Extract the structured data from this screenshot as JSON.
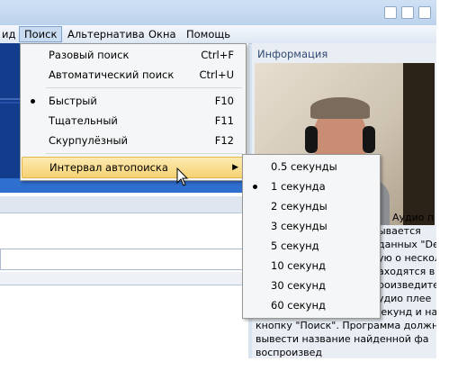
{
  "menubar": {
    "items": [
      "ид",
      "Поиск",
      "Альтернатива",
      "Окна",
      "Помощь"
    ],
    "active_index": 1
  },
  "dropdown": {
    "items": [
      {
        "label": "Разовый поиск",
        "shortcut": "Ctrl+F"
      },
      {
        "label": "Автоматический поиск",
        "shortcut": "Ctrl+U"
      },
      {
        "label": "Быстрый",
        "shortcut": "F10",
        "checked": true
      },
      {
        "label": "Тщательный",
        "shortcut": "F11"
      },
      {
        "label": "Скурпулёзный",
        "shortcut": "F12"
      },
      {
        "label": "Интервал автопоиска",
        "submenu": true
      }
    ]
  },
  "submenu": {
    "items": [
      {
        "label": "0.5 секунды"
      },
      {
        "label": "1 секунда",
        "checked": true
      },
      {
        "label": "2 секунды"
      },
      {
        "label": "3 секунды"
      },
      {
        "label": "5 секунд"
      },
      {
        "label": "10 секунд"
      },
      {
        "label": "30 секунд"
      },
      {
        "label": "60 секунд"
      }
    ]
  },
  "info": {
    "title": "Информация",
    "text_lines": [
      "Аудио п",
      "ывается",
      "данных \"Den",
      "ую о нескол.",
      "аходятся в",
      "роизведите",
      "удио плее",
      "подождите несколько секунд и нажм",
      "кнопку \"Поиск\". Программа должна",
      "вывести название найденной фа",
      "воспроизвед"
    ]
  },
  "colors": {
    "highlight": "#f5d273",
    "menu_bg": "#f5f6f7",
    "window_bg": "#d9e4f1"
  }
}
